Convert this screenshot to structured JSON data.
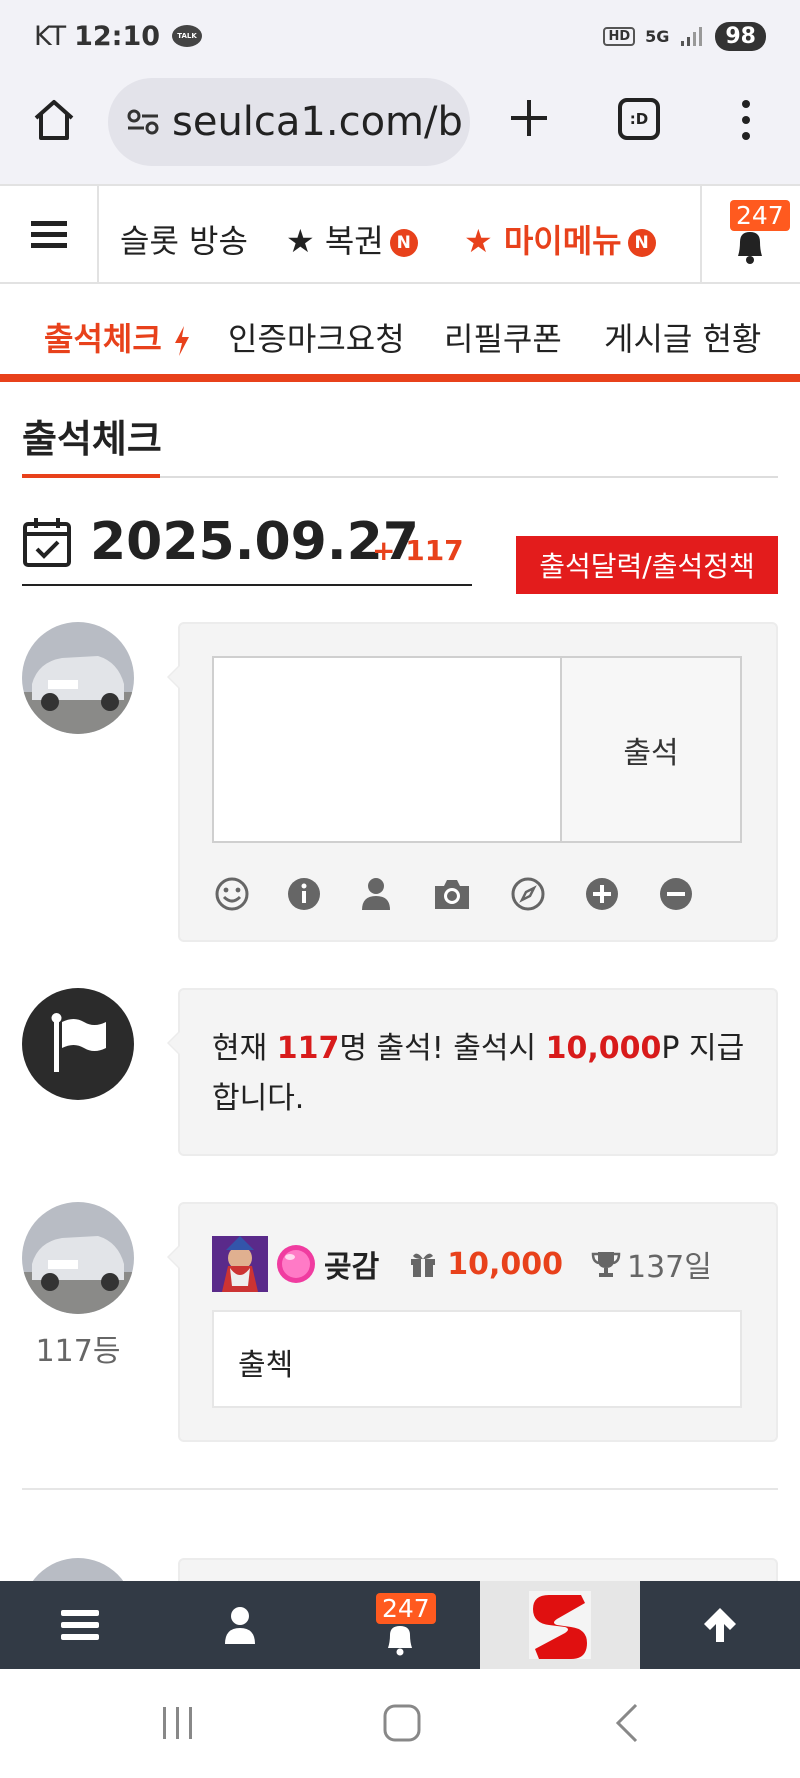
{
  "status_bar": {
    "carrier": "KT",
    "time": "12:10",
    "talk_icon_text": "TALK",
    "hd": "HD",
    "network": "5G",
    "battery": "98"
  },
  "browser": {
    "url": "seulca1.com/b",
    "tabs_label": ":D"
  },
  "site_nav": {
    "items": [
      {
        "label": "슬롯 방송"
      },
      {
        "label": "★ 복권",
        "badge": "N"
      },
      {
        "label": "★ 마이메뉴",
        "badge": "N"
      }
    ],
    "notification_count": "247"
  },
  "sub_nav": {
    "items": [
      "출석체크",
      "인증마크요청",
      "리필쿠폰",
      "게시글 현황"
    ]
  },
  "section": {
    "title": "출석체크"
  },
  "attendance": {
    "date": "2025.09.27",
    "count_label": "+ 117",
    "calendar_button": "출석달력/출석정책",
    "submit_label": "출석",
    "notice": {
      "prefix": "현재 ",
      "count": "117",
      "mid": "명 출석! 출석시 ",
      "points": "10,000",
      "suffix": "P 지급합니다."
    }
  },
  "entry": {
    "rank": "117등",
    "username": "곶감",
    "points": "10,000",
    "days": "137일",
    "message": "출첵"
  },
  "bottom_bar": {
    "notification_count": "247"
  },
  "colors": {
    "accent": "#e8411b",
    "red_button": "#e31c1c",
    "toolbar": "#323a45"
  }
}
